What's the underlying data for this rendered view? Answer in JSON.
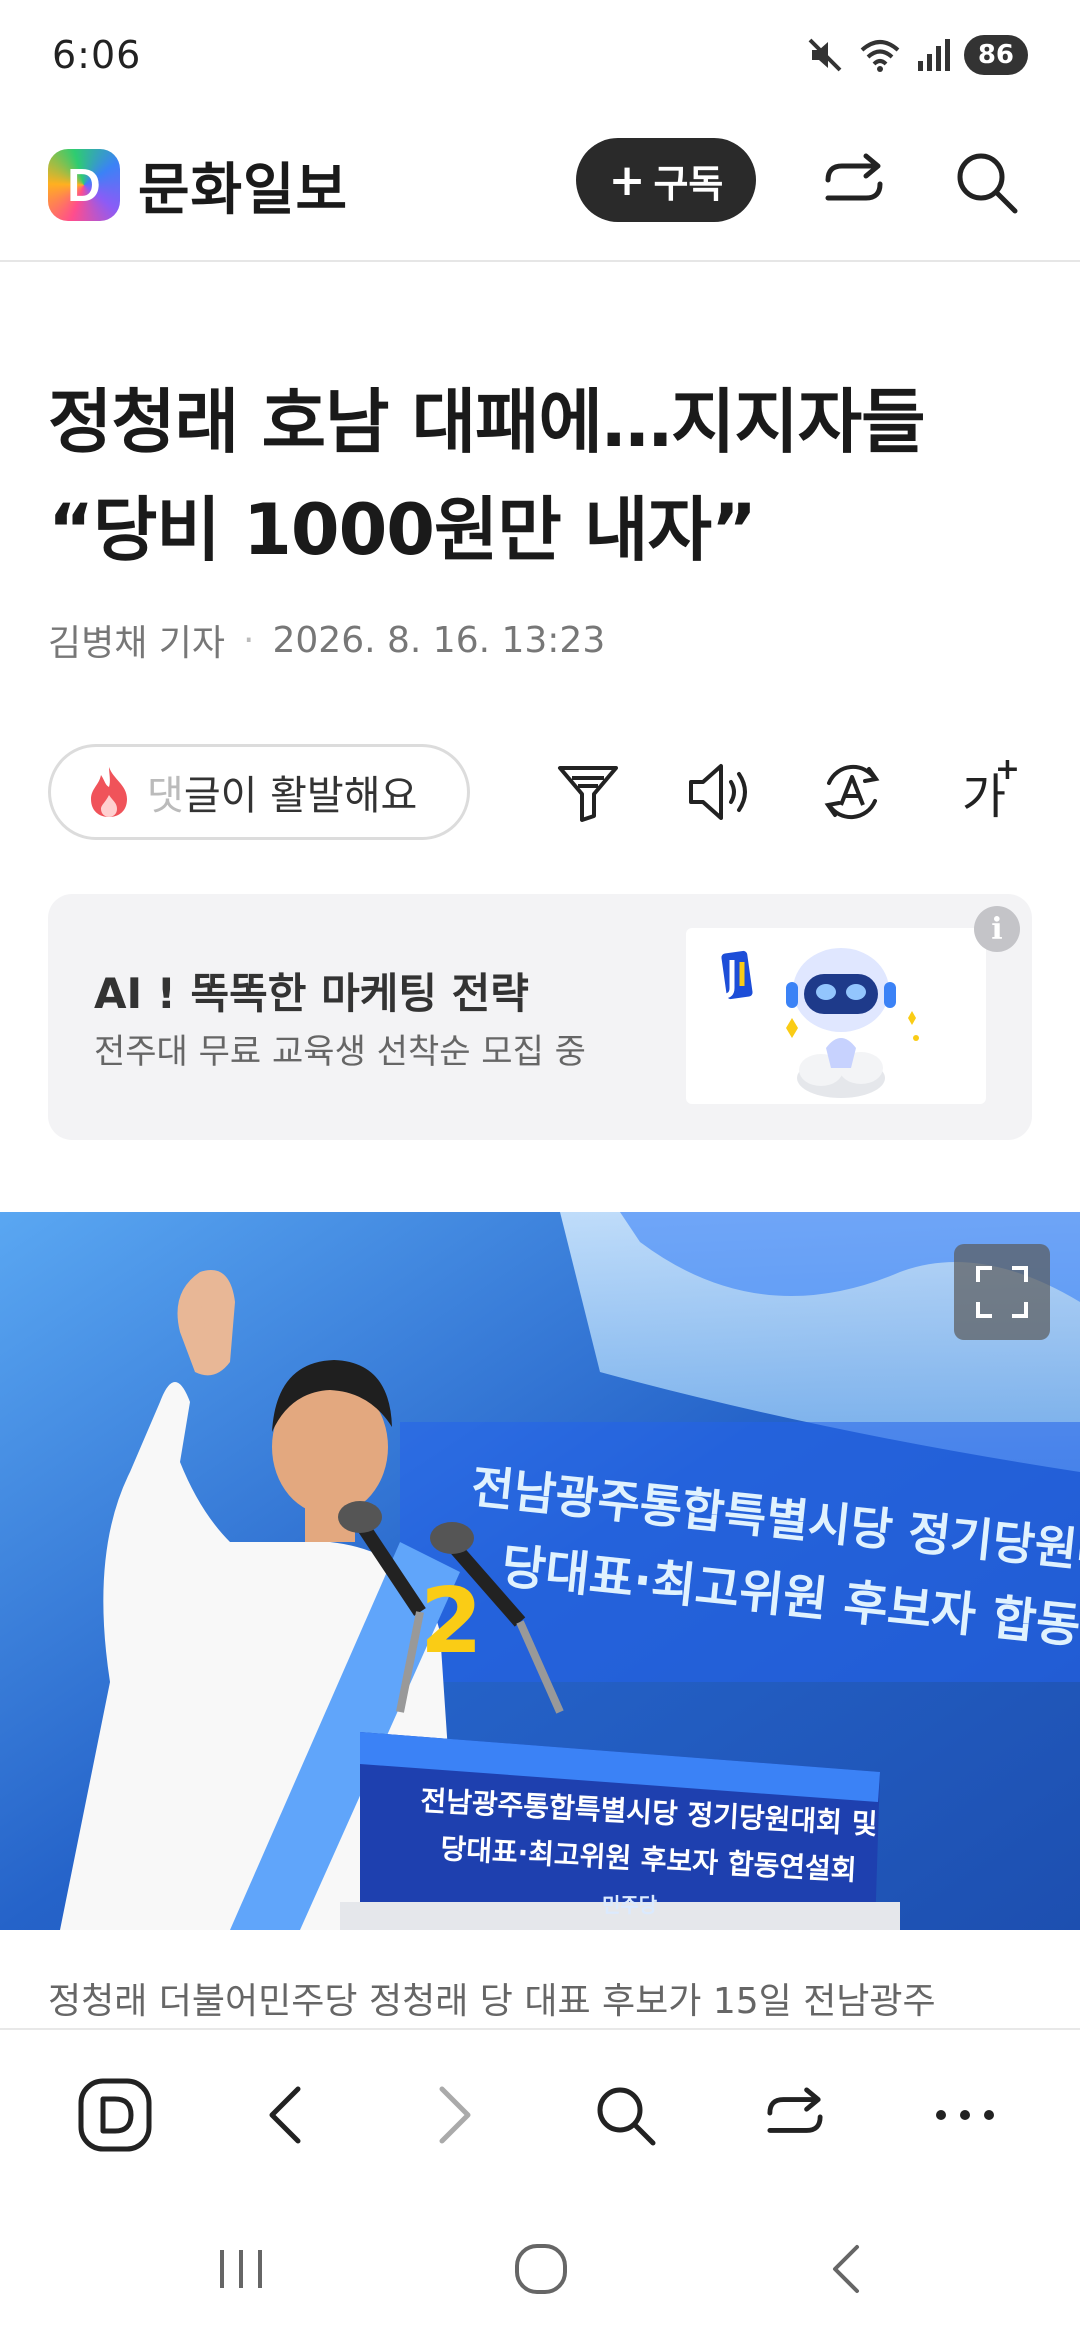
{
  "status_bar": {
    "time": "6:06",
    "battery": "86"
  },
  "header": {
    "logo_letter": "D",
    "brand": "문화일보",
    "subscribe_label": "구독"
  },
  "article": {
    "headline_line1": "정청래 호남 대패에…지지자들",
    "headline_line2": "“당비 1000원만 내자”",
    "author": "김병채 기자",
    "datetime": "2026. 8. 16. 13:23"
  },
  "tools": {
    "comment_faded": "댓",
    "comment_text": "글이 활발해요",
    "font_size_label": "가"
  },
  "ad": {
    "title": "AI ! 똑똑한 마케팅 전략",
    "subtitle": "전주대 무료 교육생 선착순 모집 중",
    "info_label": "i"
  },
  "photo": {
    "banner_line1": "전남광주통합특별시당 정기당원대회 및",
    "banner_line2": "당대표·최고위원 후보자 합동연설회",
    "podium_line1": "전남광주통합특별시당 정기당원대회 및",
    "podium_line2": "당대표·최고위원 후보자 합동연설회",
    "party_mark": "민주당",
    "sash_number": "2"
  },
  "caption": "정청래 더불어민주당 정청래 당 대표 후보가 15일 전남광주",
  "browser_bar": {
    "home_letter": "D"
  }
}
